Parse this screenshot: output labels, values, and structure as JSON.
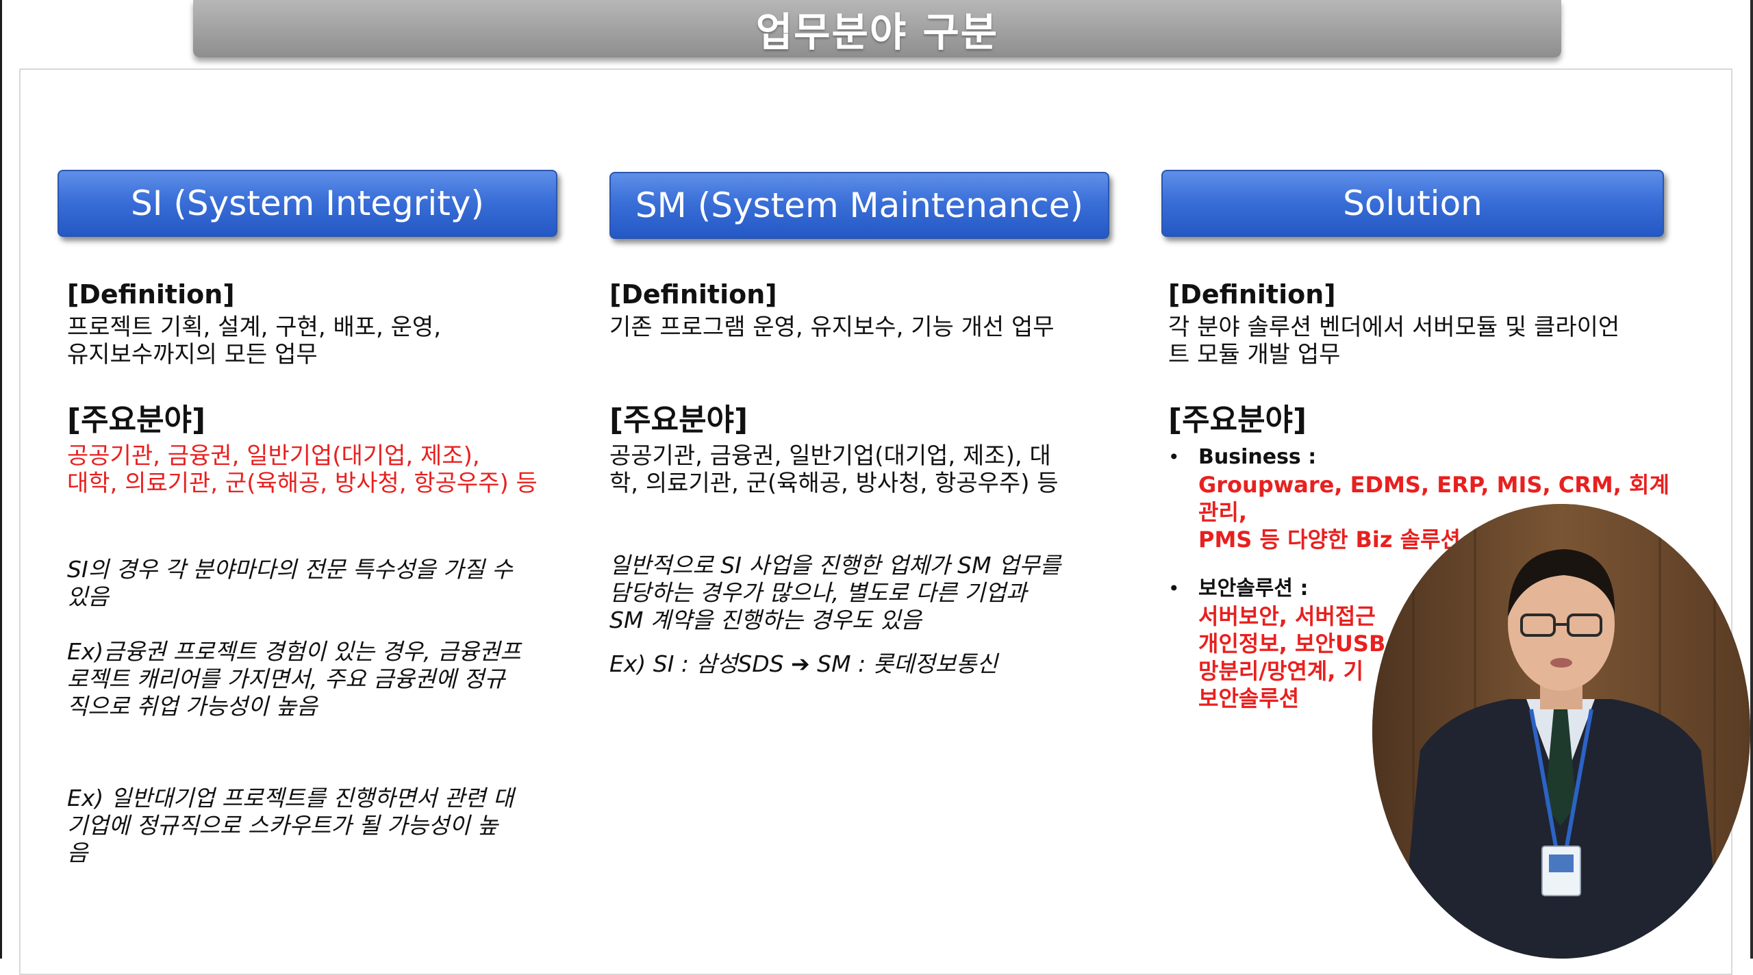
{
  "slide": {
    "title": "업무분야 구분"
  },
  "columns": [
    {
      "header": "SI (System Integrity)",
      "definition_heading": "[Definition]",
      "definition_lines": [
        "프로젝트 기획, 설계, 구현, 배포, 운영,",
        "유지보수까지의 모든 업무"
      ],
      "areas_heading": "[주요분야]",
      "areas_lines": [
        "공공기관, 금융권, 일반기업(대기업, 제조),",
        "대학, 의료기관, 군(육해공, 방사청, 항공우주) 등"
      ],
      "notes": [
        [
          "SI의 경우 각 분야마다의 전문 특수성을 가질 수",
          "있음"
        ],
        [
          "Ex)금융권 프로젝트 경험이 있는 경우, 금융권프",
          "로젝트 캐리어를 가지면서, 주요 금융권에 정규",
          "직으로 취업 가능성이 높음"
        ],
        [
          "Ex) 일반대기업 프로젝트를 진행하면서 관련 대",
          "기업에 정규직으로 스카우트가 될 가능성이 높",
          "음"
        ]
      ]
    },
    {
      "header": "SM (System Maintenance)",
      "definition_heading": "[Definition]",
      "definition_lines": [
        "기존 프로그램 운영, 유지보수, 기능 개선 업무"
      ],
      "areas_heading": "[주요분야]",
      "areas_lines": [
        "공공기관, 금융권, 일반기업(대기업, 제조), 대",
        "학, 의료기관, 군(육해공, 방사청, 항공우주) 등"
      ],
      "notes": [
        [
          "일반적으로 SI 사업을 진행한 업체가 SM 업무를",
          "담당하는 경우가 많으나, 별도로 다른 기업과",
          "SM 계약을 진행하는 경우도 있음"
        ],
        [
          "Ex) SI : 삼성SDS ➔ SM : 롯데정보통신"
        ]
      ]
    },
    {
      "header": "Solution",
      "definition_heading": "[Definition]",
      "definition_lines": [
        "각 분야 솔루션 벤더에서 서버모듈 및 클라이언",
        "트 모듈 개발 업무"
      ],
      "areas_heading": "[주요분야]",
      "bullets": [
        {
          "label": "Business :",
          "detail_lines": [
            "Groupware, EDMS, ERP, MIS, CRM, 회계관리,",
            "PMS 등 다양한 Biz 솔루션"
          ]
        },
        {
          "label": "보안솔루션 :",
          "detail_lines": [
            "서버보안, 서버접근",
            "개인정보, 보안USB",
            "망분리/망연계, 기",
            "보안솔루션"
          ]
        }
      ]
    }
  ],
  "bullet_glyph": "•",
  "presenter": {
    "icon": "presenter-video-icon"
  }
}
